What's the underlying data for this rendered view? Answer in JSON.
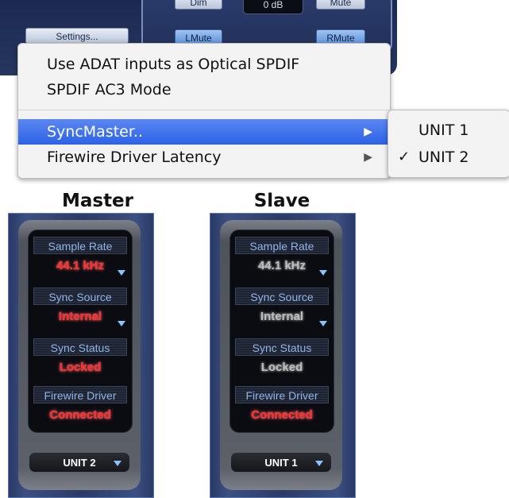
{
  "mixer": {
    "buttons": [
      "Settings...",
      "LMute",
      "RMute",
      "Dim",
      "Mute"
    ],
    "display": "0 dB"
  },
  "menu": {
    "items": [
      {
        "label": "Use ADAT inputs as Optical SPDIF"
      },
      {
        "label": "SPDIF AC3 Mode"
      },
      {
        "label": "SyncMaster..",
        "highlighted": true,
        "has_submenu": true
      },
      {
        "label": "Firewire Driver Latency",
        "has_submenu": true
      }
    ],
    "arrow_glyph": "▶"
  },
  "submenu": {
    "items": [
      {
        "label": "UNIT 1",
        "checked": false
      },
      {
        "label": "UNIT 2",
        "checked": true
      }
    ],
    "check_glyph": "✓"
  },
  "panels": [
    {
      "heading": "Master",
      "sample_rate_label": "Sample Rate",
      "sample_rate": "44.1 kHz",
      "sync_source_label": "Sync Source",
      "sync_source": "Internal",
      "sync_status_label": "Sync Status",
      "sync_status": "Locked",
      "firewire_label": "Firewire Driver",
      "firewire_status": "Connected",
      "unit": "UNIT 2"
    },
    {
      "heading": "Slave",
      "sample_rate_label": "Sample Rate",
      "sample_rate": "44.1 kHz",
      "sync_source_label": "Sync Source",
      "sync_source": "Internal",
      "sync_status_label": "Sync Status",
      "sync_status": "Locked",
      "firewire_label": "Firewire Driver",
      "firewire_status": "Connected",
      "unit": "UNIT 1"
    }
  ],
  "colors": {
    "highlight": "#2d62e6",
    "status_red": "#ff2b2b",
    "status_grey": "#bdbdbd",
    "label_blue": "#8fb4ea"
  }
}
